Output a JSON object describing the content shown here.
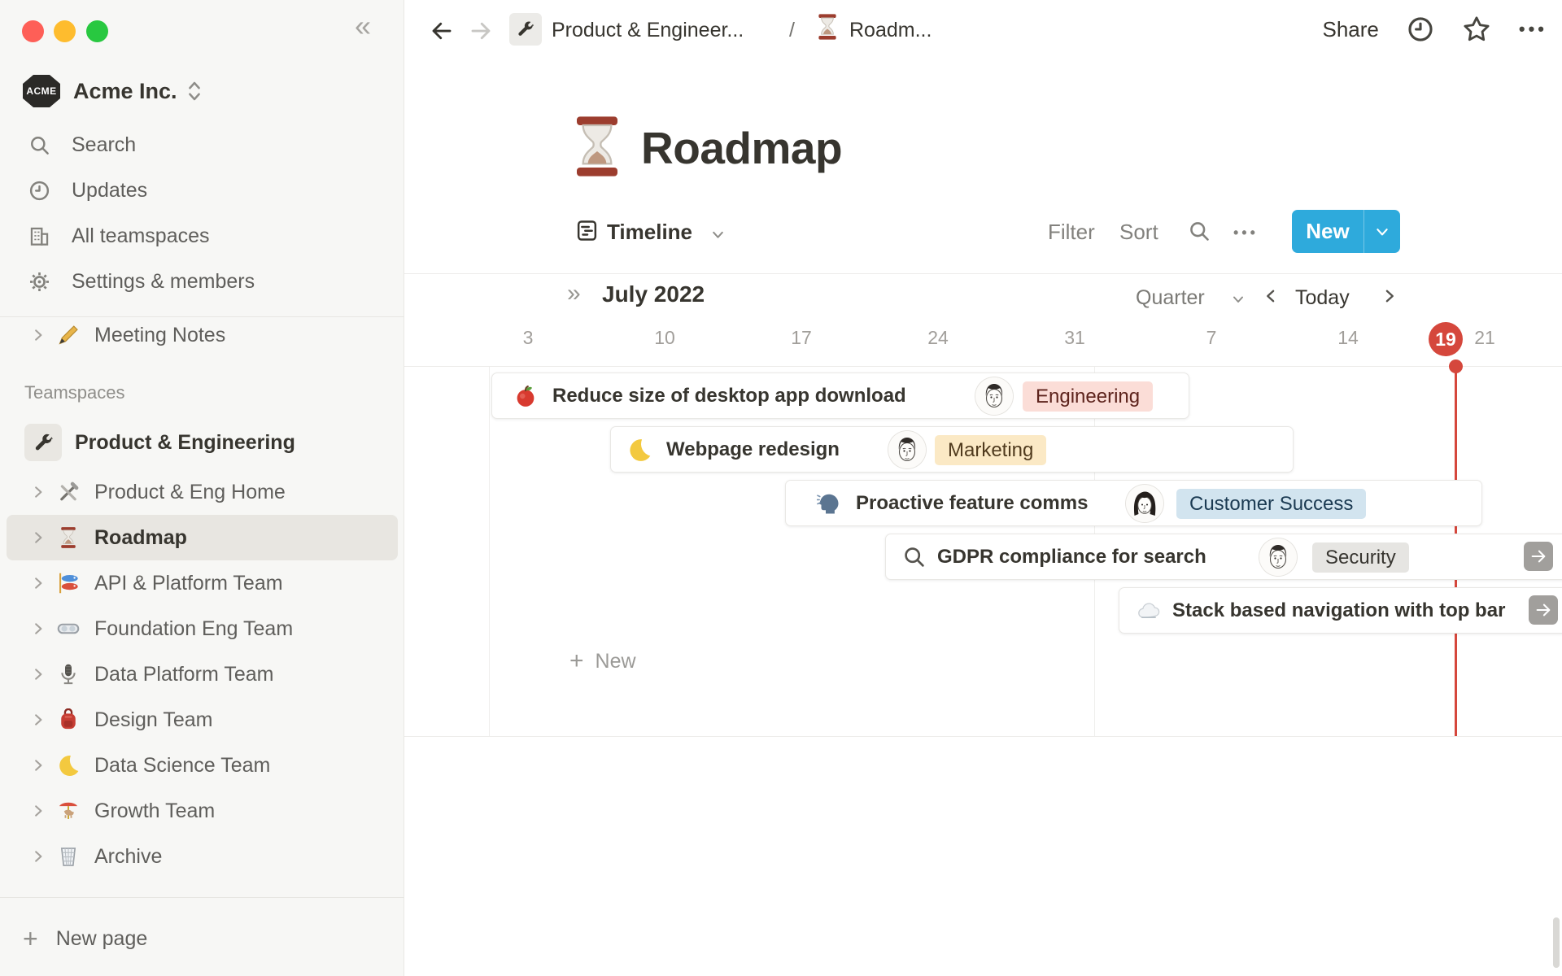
{
  "colors": {
    "accent": "#2EAADC",
    "red": "#D5473C",
    "sidebar_bg": "#F7F7F5",
    "text_dark": "#37352F",
    "text_mid": "#5F5E5B",
    "text_gray": "#9B9A97",
    "tag_red_bg": "#FBDDD7",
    "tag_red_text": "#5D231C",
    "tag_yellow_bg": "#FBE9C5",
    "tag_yellow_text": "#4F3A1D",
    "tag_blue_bg": "#D2E4EF",
    "tag_blue_text": "#1B3A52",
    "tag_gray_bg": "#E6E5E2",
    "tag_gray_text": "#373530"
  },
  "icons": {
    "collapse": "«",
    "double_chevron_right": "»",
    "more": "•••",
    "plus": "+",
    "slash": "/"
  },
  "sidebar": {
    "workspace": {
      "name": "Acme Inc.",
      "logo_text": "ACME"
    },
    "items": [
      {
        "label": "Search"
      },
      {
        "label": "Updates"
      },
      {
        "label": "All teamspaces"
      },
      {
        "label": "Settings & members"
      }
    ],
    "meeting_notes": "Meeting Notes",
    "teamspaces": {
      "header": "Teamspaces",
      "root": "Product & Engineering",
      "items": [
        "Product & Eng Home",
        "Roadmap",
        "API & Platform Team",
        "Foundation Eng Team",
        "Data Platform Team",
        "Design Team",
        "Data Science Team",
        "Growth Team",
        "Archive"
      ]
    },
    "new_page": "New page"
  },
  "topbar": {
    "breadcrumb_parent": "Product & Engineer...",
    "breadcrumb_separator": "/",
    "breadcrumb_current": "Roadm...",
    "share": "Share"
  },
  "page": {
    "title": "Roadmap"
  },
  "view_bar": {
    "view": "Timeline",
    "filter": "Filter",
    "sort": "Sort",
    "new": "New"
  },
  "timeline": {
    "month": "July 2022",
    "zoom_level": "Quarter",
    "today_button": "Today",
    "ticks": [
      "3",
      "10",
      "17",
      "24",
      "31",
      "7",
      "14",
      "21"
    ],
    "today_date": "19",
    "add_new": "New",
    "items": [
      {
        "title": "Reduce size of desktop app download",
        "tag": "Engineering"
      },
      {
        "title": "Webpage redesign",
        "tag": "Marketing"
      },
      {
        "title": "Proactive feature comms",
        "tag": "Customer Success"
      },
      {
        "title": "GDPR compliance for search",
        "tag": "Security"
      },
      {
        "title": "Stack based navigation with top bar",
        "tag": ""
      }
    ]
  }
}
